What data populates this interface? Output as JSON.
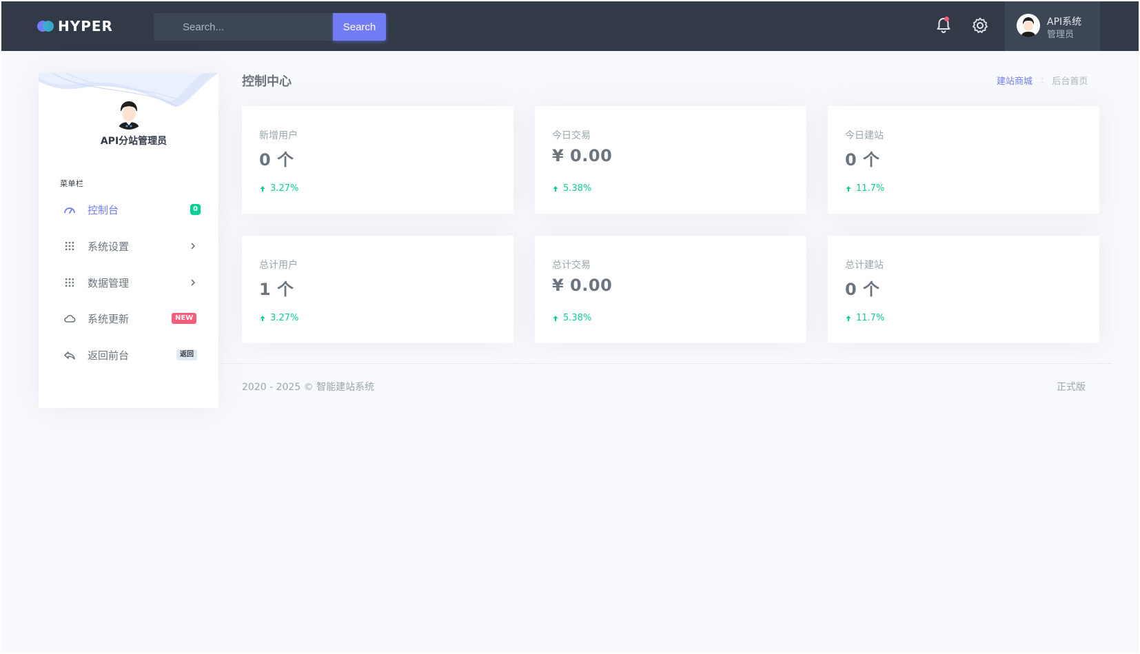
{
  "topbar": {
    "brand": "HYPER",
    "search_placeholder": "Search...",
    "search_button": "Search",
    "user_name": "API系统",
    "user_role": "管理员",
    "icons": [
      "bell-icon",
      "gear-icon"
    ],
    "accent_color": "#727cf5"
  },
  "sidebar": {
    "profile_name": "API分站管理员",
    "menu_title": "菜单栏",
    "items": [
      {
        "label": "控制台",
        "icon": "dashboard-icon",
        "badge": "0",
        "active": true
      },
      {
        "label": "系统设置",
        "icon": "grid-icon",
        "has_arrow": true
      },
      {
        "label": "数据管理",
        "icon": "grid-icon",
        "has_arrow": true
      },
      {
        "label": "系统更新",
        "icon": "cloud-icon",
        "badge": "NEW"
      },
      {
        "label": "返回前台",
        "icon": "reply-icon",
        "badge": "返回"
      }
    ]
  },
  "main": {
    "title": "控制中心",
    "breadcrumb": {
      "link": "建站商城",
      "separator": ":",
      "current": "后台首页"
    },
    "cards": [
      {
        "label": "新增用户",
        "value": "0 个",
        "trend": "3.27%"
      },
      {
        "label": "今日交易",
        "value": "¥ 0.00",
        "trend": "5.38%"
      },
      {
        "label": "今日建站",
        "value": "0 个",
        "trend": "11.7%"
      },
      {
        "label": "总计用户",
        "value": "1 个",
        "trend": "3.27%"
      },
      {
        "label": "总计交易",
        "value": "¥ 0.00",
        "trend": "5.38%"
      },
      {
        "label": "总计建站",
        "value": "0 个",
        "trend": "11.7%"
      }
    ],
    "trend_color": "#0acf97"
  },
  "footer": {
    "copyright": "2020 - 2025 © 智能建站系统",
    "version": "正式版"
  }
}
